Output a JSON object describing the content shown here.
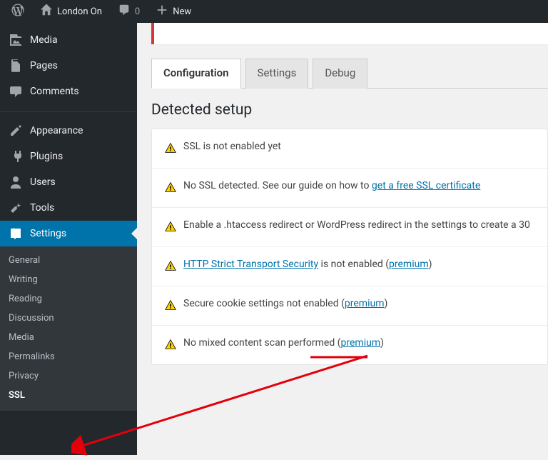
{
  "adminbar": {
    "site_name": "London On",
    "comments_count": "0",
    "new_label": "New"
  },
  "sidebar": {
    "items": [
      {
        "id": "media",
        "label": "Media"
      },
      {
        "id": "pages",
        "label": "Pages"
      },
      {
        "id": "comments",
        "label": "Comments"
      },
      {
        "id": "appearance",
        "label": "Appearance"
      },
      {
        "id": "plugins",
        "label": "Plugins"
      },
      {
        "id": "users",
        "label": "Users"
      },
      {
        "id": "tools",
        "label": "Tools"
      },
      {
        "id": "settings",
        "label": "Settings",
        "current": true
      }
    ],
    "submenu": [
      {
        "label": "General"
      },
      {
        "label": "Writing"
      },
      {
        "label": "Reading"
      },
      {
        "label": "Discussion"
      },
      {
        "label": "Media"
      },
      {
        "label": "Permalinks"
      },
      {
        "label": "Privacy"
      },
      {
        "label": "SSL",
        "current": true
      }
    ]
  },
  "tabs": [
    {
      "label": "Configuration",
      "active": true
    },
    {
      "label": "Settings"
    },
    {
      "label": "Debug"
    }
  ],
  "section_title": "Detected setup",
  "rows": [
    {
      "pre": "SSL is not enabled yet"
    },
    {
      "pre": "No SSL detected. See our guide on how to ",
      "link": "get a free SSL certificate"
    },
    {
      "pre": "Enable a .htaccess redirect or WordPress redirect in the settings to create a 30"
    },
    {
      "link_first": "HTTP Strict Transport Security",
      "mid": " is not enabled (",
      "link2": "premium",
      "post": ")"
    },
    {
      "pre": "Secure cookie settings not enabled (",
      "link": "premium",
      "post": ")"
    },
    {
      "pre": "No mixed content scan performed (",
      "link": "premium",
      "post": ")"
    }
  ]
}
